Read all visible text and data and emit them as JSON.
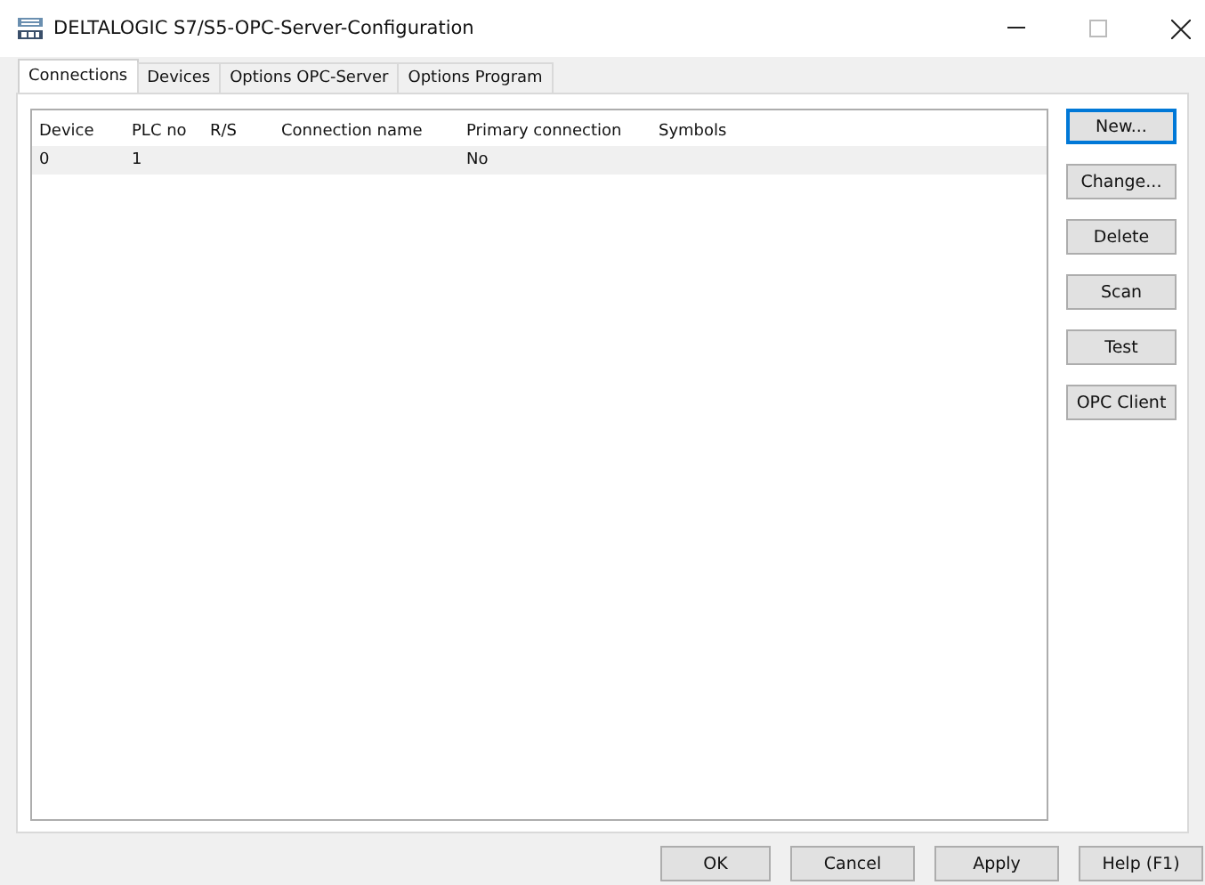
{
  "window": {
    "title": "DELTALOGIC S7/S5-OPC-Server-Configuration"
  },
  "tabs": [
    {
      "label": "Connections",
      "selected": true
    },
    {
      "label": "Devices",
      "selected": false
    },
    {
      "label": "Options OPC-Server",
      "selected": false
    },
    {
      "label": "Options Program",
      "selected": false
    }
  ],
  "table": {
    "columns": [
      "Device",
      "PLC no",
      "R/S",
      "Connection name",
      "Primary connection",
      "Symbols"
    ],
    "rows": [
      {
        "cells": [
          "0",
          "1",
          "",
          "",
          "No",
          ""
        ],
        "selected": true
      }
    ]
  },
  "side_buttons": [
    {
      "label": "New...",
      "default": true
    },
    {
      "label": "Change...",
      "default": false
    },
    {
      "label": "Delete",
      "default": false
    },
    {
      "label": "Scan",
      "default": false
    },
    {
      "label": "Test",
      "default": false
    },
    {
      "label": "OPC Client",
      "default": false
    }
  ],
  "buttons": [
    "OK",
    "Cancel",
    "Apply",
    "Help (F1)"
  ]
}
